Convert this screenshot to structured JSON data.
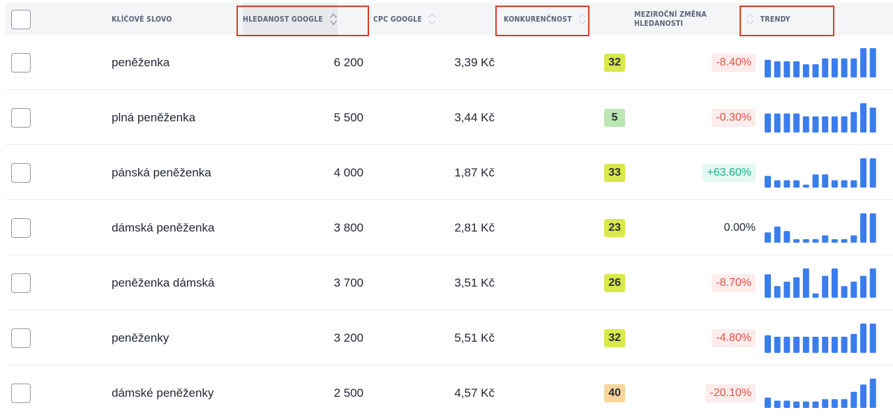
{
  "header": {
    "keyword": "KLÍČOVÉ SLOVO",
    "search": "HLEDANOST GOOGLE",
    "cpc": "CPC GOOGLE",
    "competition": "KONKURENČNOST",
    "change_line1": "MEZIROČNÍ ZMĚNA",
    "change_line2": "HLEDANOSTI",
    "trends": "TRENDY"
  },
  "colors": {
    "bar": "#3b7ded",
    "badge_yellow": "#d9e84a",
    "badge_green": "#b9e6b3",
    "badge_orange": "#f7d59a",
    "highlight": "#d93a28"
  },
  "rows": [
    {
      "keyword": "peněženka",
      "search": "6 200",
      "cpc": "3,39 Kč",
      "competition": "32",
      "competition_color": "#d9e84a",
      "change": "-8.40%",
      "change_type": "neg",
      "trend": [
        0.6,
        0.55,
        0.55,
        0.55,
        0.45,
        0.45,
        0.65,
        0.65,
        0.65,
        0.65,
        1.0,
        1.0
      ]
    },
    {
      "keyword": "plná peněženka",
      "search": "5 500",
      "cpc": "3,44 Kč",
      "competition": "5",
      "competition_color": "#b9e6b3",
      "change": "-0.30%",
      "change_type": "neg",
      "trend": [
        0.65,
        0.65,
        0.65,
        0.65,
        0.55,
        0.55,
        0.55,
        0.55,
        0.55,
        0.7,
        1.0,
        0.85
      ]
    },
    {
      "keyword": "pánská peněženka",
      "search": "4 000",
      "cpc": "1,87 Kč",
      "competition": "33",
      "competition_color": "#d9e84a",
      "change": "+63.60%",
      "change_type": "pos",
      "trend": [
        0.4,
        0.25,
        0.25,
        0.25,
        0.1,
        0.45,
        0.45,
        0.25,
        0.25,
        0.25,
        1.0,
        1.0
      ]
    },
    {
      "keyword": "dámská peněženka",
      "search": "3 800",
      "cpc": "2,81 Kč",
      "competition": "23",
      "competition_color": "#d9e84a",
      "change": "0.00%",
      "change_type": "zero",
      "trend": [
        0.35,
        0.55,
        0.4,
        0.12,
        0.12,
        0.12,
        0.25,
        0.12,
        0.12,
        0.25,
        1.0,
        1.0
      ]
    },
    {
      "keyword": "peněženka dámská",
      "search": "3 700",
      "cpc": "3,51 Kč",
      "competition": "26",
      "competition_color": "#d9e84a",
      "change": "-8.70%",
      "change_type": "neg",
      "trend": [
        0.8,
        0.4,
        0.55,
        0.7,
        1.0,
        0.15,
        0.75,
        1.0,
        0.4,
        0.55,
        0.75,
        1.0
      ]
    },
    {
      "keyword": "peněženky",
      "search": "3 200",
      "cpc": "5,51 Kč",
      "competition": "32",
      "competition_color": "#d9e84a",
      "change": "-4.80%",
      "change_type": "neg",
      "trend": [
        0.6,
        0.55,
        0.55,
        0.55,
        0.55,
        0.55,
        0.55,
        0.55,
        0.55,
        0.65,
        1.0,
        1.0
      ]
    },
    {
      "keyword": "dámské peněženky",
      "search": "2 500",
      "cpc": "4,57 Kč",
      "competition": "40",
      "competition_color": "#f7d59a",
      "change": "-20.10%",
      "change_type": "neg",
      "trend": [
        0.35,
        0.25,
        0.25,
        0.22,
        0.22,
        0.22,
        0.3,
        0.3,
        0.3,
        0.55,
        0.8,
        1.0
      ]
    }
  ]
}
